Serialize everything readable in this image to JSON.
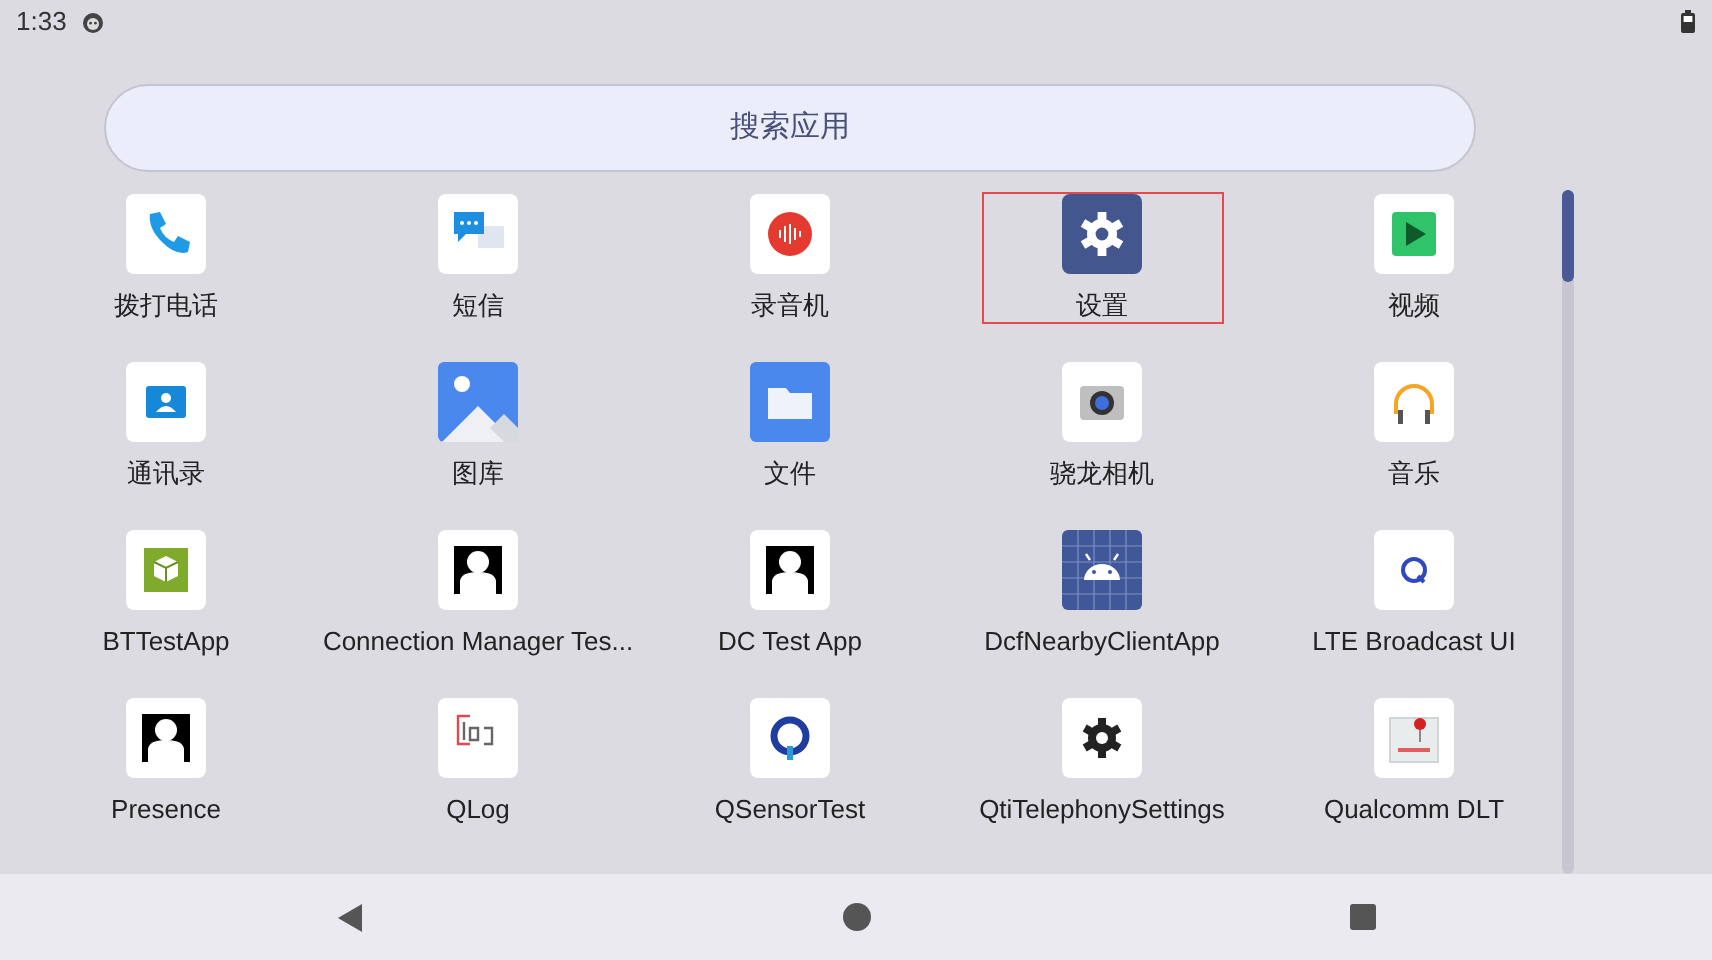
{
  "status_bar": {
    "time": "1:33"
  },
  "search": {
    "placeholder": "搜索应用"
  },
  "apps": [
    {
      "label": "拨打电话",
      "selected": false
    },
    {
      "label": "短信",
      "selected": false
    },
    {
      "label": "录音机",
      "selected": false
    },
    {
      "label": "设置",
      "selected": true
    },
    {
      "label": "视频",
      "selected": false
    },
    {
      "label": "通讯录",
      "selected": false
    },
    {
      "label": "图库",
      "selected": false
    },
    {
      "label": "文件",
      "selected": false
    },
    {
      "label": "骁龙相机",
      "selected": false
    },
    {
      "label": "音乐",
      "selected": false
    },
    {
      "label": "BTTestApp",
      "selected": false
    },
    {
      "label": "Connection Manager Tes...",
      "selected": false
    },
    {
      "label": "DC Test App",
      "selected": false
    },
    {
      "label": "DcfNearbyClientApp",
      "selected": false
    },
    {
      "label": "LTE Broadcast UI",
      "selected": false
    },
    {
      "label": "Presence",
      "selected": false
    },
    {
      "label": "QLog",
      "selected": false
    },
    {
      "label": "QSensorTest",
      "selected": false
    },
    {
      "label": "QtiTelephonySettings",
      "selected": false
    },
    {
      "label": "Qualcomm DLT",
      "selected": false
    }
  ]
}
